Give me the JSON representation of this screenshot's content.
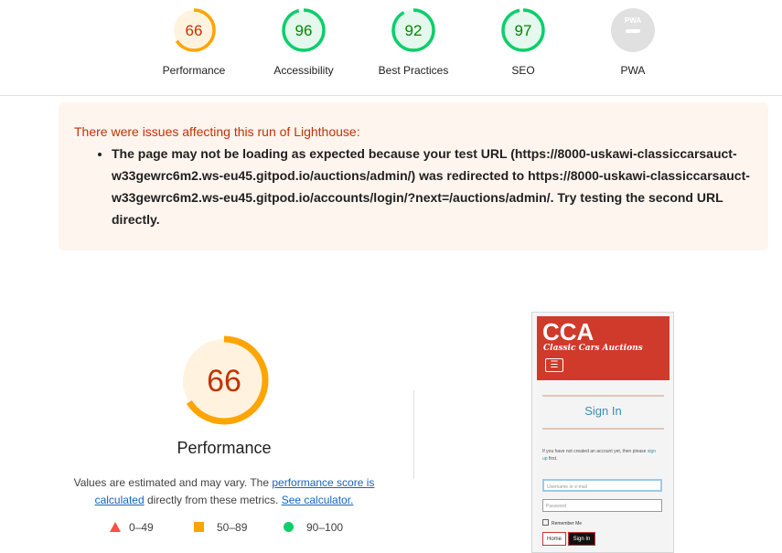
{
  "gauges": [
    {
      "score": "66",
      "label": "Performance",
      "color": "#ffa400",
      "fill": "#fff3e0",
      "text_color": "#c33300",
      "pct": 0.66
    },
    {
      "score": "96",
      "label": "Accessibility",
      "color": "#0cce6b",
      "fill": "#e5f8ee",
      "text_color": "#008800",
      "pct": 0.96
    },
    {
      "score": "92",
      "label": "Best Practices",
      "color": "#0cce6b",
      "fill": "#e5f8ee",
      "text_color": "#008800",
      "pct": 0.92
    },
    {
      "score": "97",
      "label": "SEO",
      "color": "#0cce6b",
      "fill": "#e5f8ee",
      "text_color": "#008800",
      "pct": 0.97
    },
    {
      "score": "",
      "label": "PWA",
      "badge_text": "PWA",
      "color": "#e0e0e0"
    }
  ],
  "warning": {
    "title": "There were issues affecting this run of Lighthouse:",
    "items": [
      "The page may not be loading as expected because your test URL (https://8000-uskawi-classiccarsauct-w33gewrc6m2.ws-eu45.gitpod.io/auctions/admin/) was redirected to https://8000-uskawi-classiccarsauct-w33gewrc6m2.ws-eu45.gitpod.io/accounts/login/?next=/auctions/admin/. Try testing the second URL directly."
    ]
  },
  "performance": {
    "score": "66",
    "pct": 0.66,
    "title": "Performance",
    "desc_prefix": "Values are estimated and may vary. The ",
    "desc_link": "performance score is calculated",
    "desc_middle": " directly from these metrics. ",
    "desc_link2": "See calculator."
  },
  "legend": {
    "fail": "0–49",
    "average": "50–89",
    "pass": "90–100"
  },
  "thumbnail": {
    "logo": "CCA",
    "tagline": "Classic Cars Auctions",
    "menu_icon": "☰",
    "signin": "Sign In",
    "notice_prefix": "If you have not created an account yet, then please ",
    "notice_link": "sign up",
    "notice_suffix": " first.",
    "username_placeholder": "Username or e-mail",
    "password_placeholder": "Password",
    "remember": "Remember Me",
    "home_btn": "Home",
    "signin_btn": "Sign In"
  }
}
